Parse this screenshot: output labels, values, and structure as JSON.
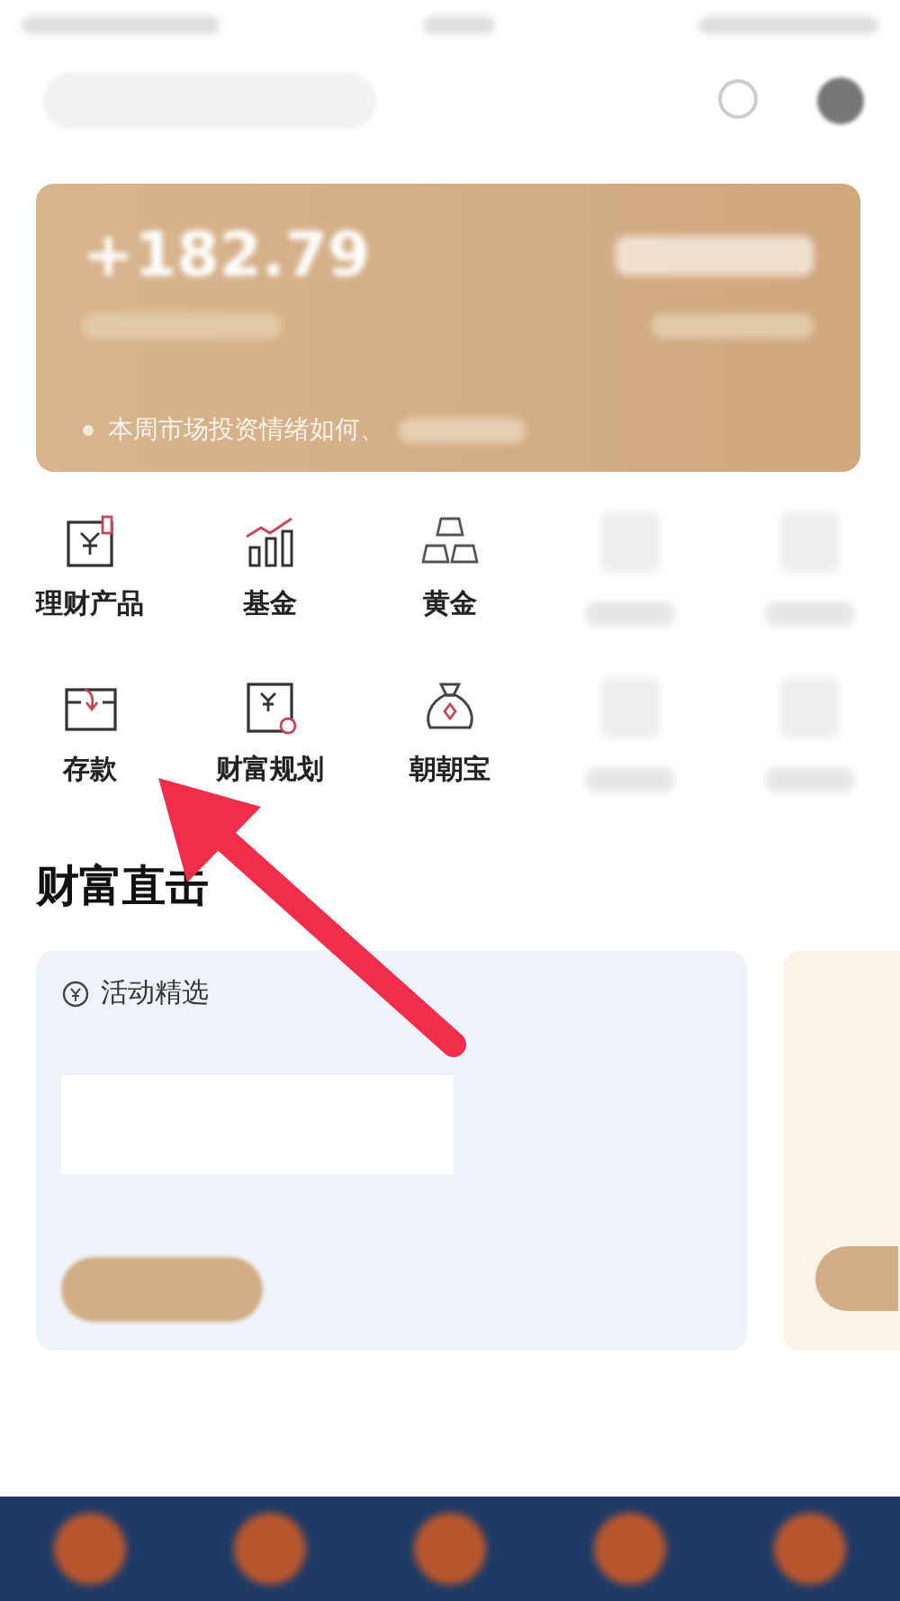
{
  "balance_card": {
    "amount": "+182.79",
    "notice": "本周市场投资情绪如何、"
  },
  "menu": [
    {
      "kind": "text",
      "label": "理财产品"
    },
    {
      "kind": "text",
      "label": "基金"
    },
    {
      "kind": "text",
      "label": "黄金"
    },
    {
      "kind": "blurred"
    },
    {
      "kind": "blurred"
    },
    {
      "kind": "text",
      "label": "存款"
    },
    {
      "kind": "text",
      "label": "财富规划"
    },
    {
      "kind": "text",
      "label": "朝朝宝"
    },
    {
      "kind": "blurred"
    },
    {
      "kind": "blurred"
    }
  ],
  "section": {
    "title": "财富直击",
    "card_title": "活动精选"
  }
}
